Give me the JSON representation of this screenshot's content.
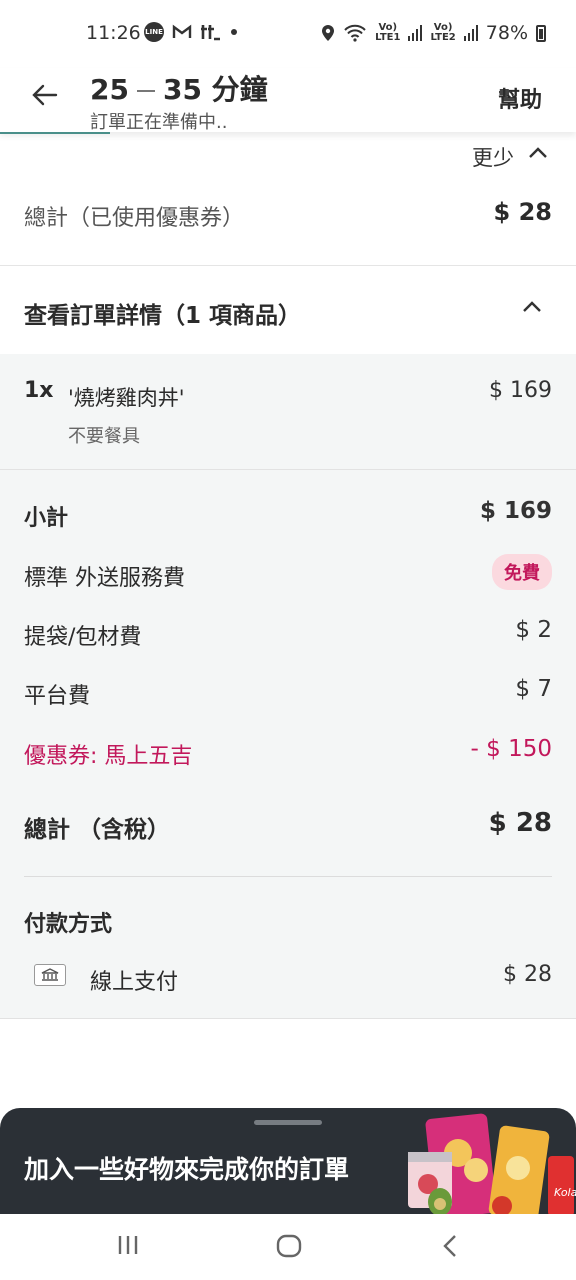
{
  "status_bar": {
    "time": "11:26",
    "battery": "78%",
    "left_icons": [
      "line-app-icon",
      "gmail-icon",
      "tiktok-icon",
      "dot-icon"
    ],
    "right_icons": [
      "location-icon",
      "wifi-icon",
      "volte1-signal-icon",
      "volte2-signal-icon",
      "battery-icon"
    ]
  },
  "header": {
    "eta_start": "25",
    "eta_end": "35 分鐘",
    "subtitle": "訂單正在準備中..",
    "help": "幫助"
  },
  "less": {
    "label": "更少"
  },
  "total_top": {
    "label": "總計（已使用優惠券）",
    "value": "$ 28"
  },
  "details": {
    "title": "查看訂單詳情（1 項商品）"
  },
  "item": {
    "qty": "1x",
    "name": "'燒烤雞肉丼'",
    "note": "不要餐具",
    "price": "$ 169"
  },
  "summary": {
    "subtotal_label": "小計",
    "subtotal_value": "$ 169",
    "delivery_label": "標準 外送服務費",
    "delivery_value": "免費",
    "bag_label": "提袋/包材費",
    "bag_value": "$ 2",
    "platform_label": "平台費",
    "platform_value": "$ 7",
    "coupon_label": "優惠券: 馬上五吉",
    "coupon_value": "- $ 150",
    "total_label": "總計 （含稅）",
    "total_value": "$ 28"
  },
  "payment": {
    "title": "付款方式",
    "method": "線上支付",
    "amount": "$ 28"
  },
  "bottom_sheet": {
    "promo": "加入一些好物來完成你的訂單"
  },
  "colors": {
    "accent_pink": "#c2185b",
    "badge_bg": "#fbd9df",
    "sheet_bg": "#2b3036",
    "gray_bg": "#f4f6f6"
  }
}
